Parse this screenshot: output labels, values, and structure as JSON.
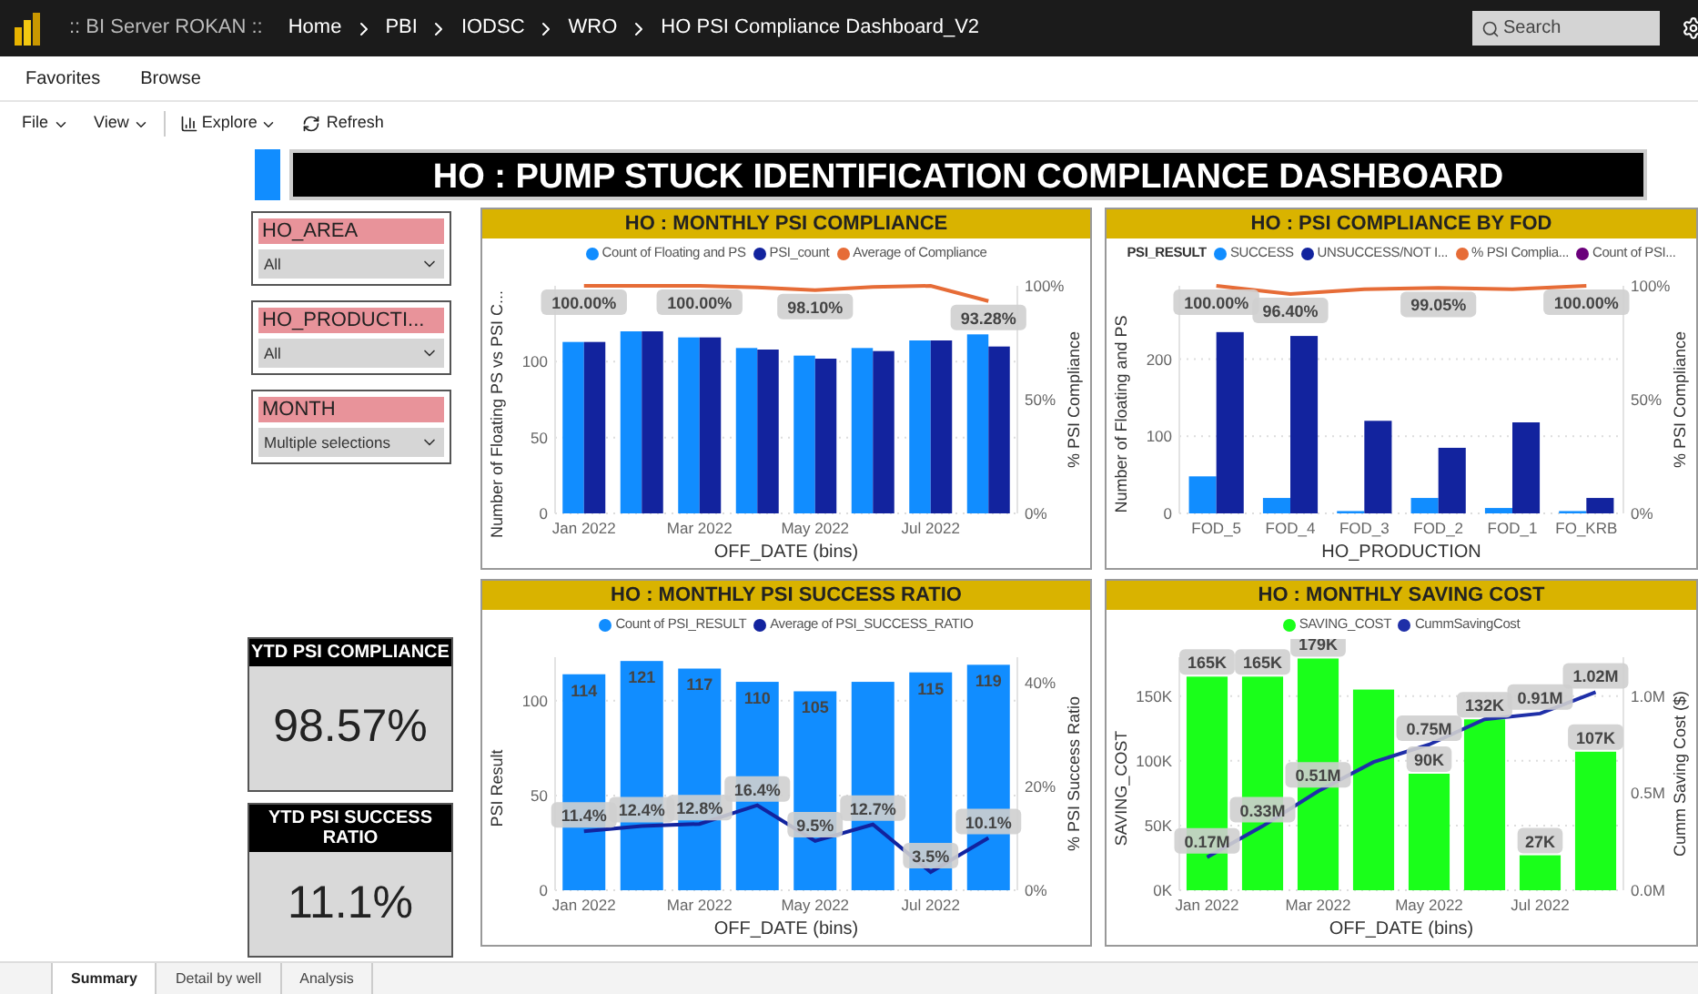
{
  "app": {
    "breadcrumb": [
      ":: BI Server ROKAN ::",
      "Home",
      "PBI",
      "IODSC",
      "WRO",
      "HO PSI Compliance Dashboard_V2"
    ],
    "search": {
      "placeholder": "Search"
    }
  },
  "nav": [
    "Favorites",
    "Browse"
  ],
  "toolbar": [
    {
      "label": "File",
      "kind": "menu"
    },
    {
      "label": "View",
      "kind": "menu"
    },
    {
      "label": "Explore",
      "kind": "explore"
    },
    {
      "label": "Refresh",
      "kind": "refresh"
    }
  ],
  "report": {
    "title": "HO : PUMP STUCK IDENTIFICATION COMPLIANCE DASHBOARD",
    "slicers": [
      {
        "label": "HO_AREA",
        "value": "All"
      },
      {
        "label": "HO_PRODUCTI...",
        "value": "All"
      },
      {
        "label": "MONTH",
        "value": "Multiple selections"
      }
    ],
    "cards": [
      {
        "title": "YTD PSI COMPLIANCE",
        "value": "98.57%"
      },
      {
        "title": "YTD PSI SUCCESS RATIO",
        "value": "11.1%"
      }
    ],
    "charts": [
      {
        "chart_data": {
          "type": "bar",
          "stacked": false,
          "grid": true,
          "legend": "top",
          "title": "HO : MONTHLY PSI COMPLIANCE",
          "xlabel": "OFF_DATE (bins)",
          "ylabel": "Number of Floating PS vs PSI C...",
          "y2label": "% PSI Compliance",
          "categories": [
            "Jan 2022",
            null,
            "Mar 2022",
            null,
            "May 2022",
            null,
            "Jul 2022",
            null
          ],
          "ylim": [
            0,
            150
          ],
          "y2lim": [
            0,
            100
          ],
          "yticks": [
            0,
            50,
            100
          ],
          "y2ticks": [
            {
              "value": 0,
              "label": "0%"
            },
            {
              "value": 50,
              "label": "50%"
            },
            {
              "value": 100,
              "label": "100%"
            }
          ],
          "series": [
            {
              "name": "Count of Floating and PS",
              "type": "bar",
              "color": "#118dff",
              "values": [
                113,
                120,
                116,
                109,
                104,
                109,
                114,
                118
              ]
            },
            {
              "name": "PSI_count",
              "type": "bar",
              "color": "#12239e",
              "values": [
                113,
                120,
                116,
                108,
                102,
                107,
                114,
                110
              ]
            },
            {
              "name": "Average of Compliance",
              "type": "line",
              "axis": "y2",
              "color": "#e66c37",
              "values": [
                100,
                100,
                100,
                99.3,
                98.1,
                99.5,
                100,
                93.28
              ],
              "value_labels": [
                "100.00%",
                null,
                "100.00%",
                null,
                "98.10%",
                null,
                null,
                "93.28%"
              ]
            }
          ]
        }
      },
      {
        "legend_title": "PSI_RESULT",
        "legend_extra": [
          {
            "label": "Count of PSI...",
            "color": "#6b007b"
          }
        ],
        "chart_data": {
          "type": "bar",
          "stacked": false,
          "grid": true,
          "legend": "top",
          "title": "HO : PSI COMPLIANCE BY FOD",
          "xlabel": "HO_PRODUCTION",
          "ylabel": "Number of Floating and PS",
          "y2label": "% PSI Compliance",
          "categories": [
            "FOD_5",
            "FOD_4",
            "FOD_3",
            "FOD_2",
            "FOD_1",
            "FO_KRB"
          ],
          "ylim": [
            0,
            295
          ],
          "y2lim": [
            0,
            100
          ],
          "yticks": [
            0,
            100,
            200
          ],
          "y2ticks": [
            {
              "value": 0,
              "label": "0%"
            },
            {
              "value": 50,
              "label": "50%"
            },
            {
              "value": 100,
              "label": "100%"
            }
          ],
          "series": [
            {
              "name": "SUCCESS",
              "type": "bar",
              "color": "#118dff",
              "values": [
                48,
                20,
                3,
                20,
                7,
                3
              ]
            },
            {
              "name": "UNSUCCESS/NOT I...",
              "type": "bar",
              "color": "#12239e",
              "values": [
                235,
                230,
                120,
                85,
                118,
                20
              ]
            },
            {
              "name": "% PSI Complia...",
              "type": "line",
              "axis": "y2",
              "color": "#e66c37",
              "values": [
                100,
                96.4,
                98.5,
                99.05,
                98.5,
                100
              ],
              "value_labels": [
                "100.00%",
                "96.40%",
                null,
                "99.05%",
                null,
                "100.00%"
              ]
            }
          ]
        }
      },
      {
        "labels_inside": true,
        "chart_data": {
          "type": "bar",
          "stacked": false,
          "grid": true,
          "legend": "top",
          "title": "HO : MONTHLY PSI SUCCESS RATIO",
          "xlabel": "OFF_DATE (bins)",
          "ylabel": "PSI Result",
          "y2label": "% PSI Success Ratio",
          "categories": [
            "Jan 2022",
            null,
            "Mar 2022",
            null,
            "May 2022",
            null,
            "Jul 2022",
            null
          ],
          "ylim": [
            0,
            123
          ],
          "y2lim": [
            0,
            45
          ],
          "yticks": [
            0,
            50,
            100
          ],
          "y2ticks": [
            {
              "value": 0,
              "label": "0%"
            },
            {
              "value": 20,
              "label": "20%"
            },
            {
              "value": 40,
              "label": "40%"
            }
          ],
          "series": [
            {
              "name": "Count of PSI_RESULT",
              "type": "bar",
              "color": "#118dff",
              "values": [
                114,
                121,
                117,
                110,
                105,
                110,
                115,
                119
              ],
              "value_labels": [
                "114",
                "121",
                "117",
                "110",
                "105",
                null,
                "115",
                "119"
              ]
            },
            {
              "name": "Average of PSI_SUCCESS_RATIO",
              "type": "line",
              "axis": "y2",
              "color": "#12239e",
              "values": [
                11.4,
                12.4,
                12.8,
                16.4,
                9.5,
                12.7,
                3.5,
                10.1
              ],
              "value_labels": [
                "11.4%",
                "12.4%",
                "12.8%",
                "16.4%",
                "9.5%",
                "12.7%",
                "3.5%",
                "10.1%"
              ]
            }
          ]
        }
      },
      {
        "labels_inside": false,
        "chart_data": {
          "type": "bar",
          "stacked": false,
          "grid": true,
          "legend": "top",
          "title": "HO : MONTHLY SAVING COST",
          "xlabel": "OFF_DATE (bins)",
          "ylabel": "SAVING_COST",
          "y2label": "Cumm Saving Cost ($)",
          "categories": [
            "Jan 2022",
            null,
            "Mar 2022",
            null,
            "May 2022",
            null,
            "Jul 2022",
            null
          ],
          "ylim": [
            0,
            180
          ],
          "y2lim": [
            0,
            1.2
          ],
          "yticks": [
            {
              "value": 0,
              "label": "0K"
            },
            {
              "value": 50,
              "label": "50K"
            },
            {
              "value": 100,
              "label": "100K"
            },
            {
              "value": 150,
              "label": "150K"
            }
          ],
          "y2ticks": [
            {
              "value": 0,
              "label": "0.0M"
            },
            {
              "value": 0.5,
              "label": "0.5M"
            },
            {
              "value": 1,
              "label": "1.0M"
            }
          ],
          "series": [
            {
              "name": "SAVING_COST",
              "type": "bar",
              "color": "#1aff1a",
              "values": [
                165,
                165,
                179,
                155,
                90,
                132,
                27,
                107
              ],
              "value_labels": [
                "165K",
                "165K",
                "179K",
                null,
                "90K",
                "132K",
                "27K",
                "107K"
              ]
            },
            {
              "name": "CummSavingCost",
              "type": "line",
              "axis": "y2",
              "color": "#1f2fa8",
              "values": [
                0.17,
                0.33,
                0.51,
                0.66,
                0.75,
                0.88,
                0.91,
                1.02
              ],
              "value_labels": [
                "0.17M",
                "0.33M",
                "0.51M",
                null,
                "0.75M",
                null,
                "0.91M",
                "1.02M"
              ]
            }
          ]
        }
      }
    ]
  },
  "pages": [
    {
      "label": "Summary",
      "selected": true
    },
    {
      "label": "Detail by well",
      "selected": false
    },
    {
      "label": "Analysis",
      "selected": false
    }
  ]
}
